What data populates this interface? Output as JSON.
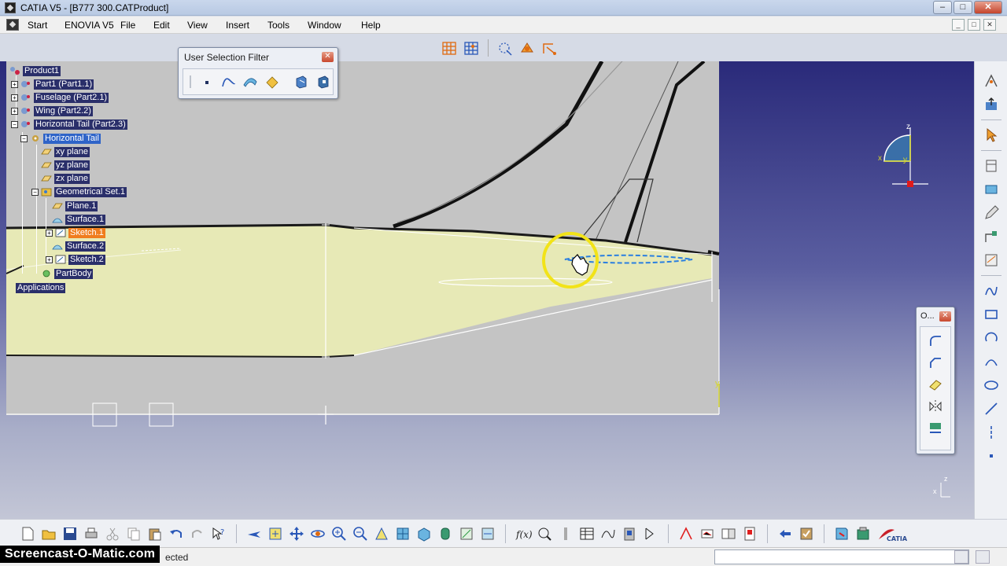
{
  "window": {
    "title": "CATIA V5 - [B777 300.CATProduct]",
    "minimize": "–",
    "restore": "□",
    "close": "✕"
  },
  "menu": {
    "items": [
      {
        "label": "Start"
      },
      {
        "label": "ENOVIA V5"
      },
      {
        "label": "File"
      },
      {
        "label": "Edit"
      },
      {
        "label": "View"
      },
      {
        "label": "Insert"
      },
      {
        "label": "Tools"
      },
      {
        "label": "Window"
      },
      {
        "label": "Help"
      }
    ],
    "mdi_min": "_",
    "mdi_restore": "□",
    "mdi_close": "✕"
  },
  "tree": {
    "root": "Product1",
    "part1": "Part1 (Part1.1)",
    "fuselage": "Fuselage (Part2.1)",
    "wing": "Wing (Part2.2)",
    "htail": "Horizontal Tail (Part2.3)",
    "htail_part": "Horizontal Tail",
    "xy_plane": "xy plane",
    "yz_plane": "yz plane",
    "zx_plane": "zx plane",
    "geoset": "Geometrical Set.1",
    "plane1": "Plane.1",
    "surface1": "Surface.1",
    "sketch1": "Sketch.1",
    "surface2": "Surface.2",
    "sketch2": "Sketch.2",
    "partbody": "PartBody",
    "applications": "Applications"
  },
  "selection_filter": {
    "title": "User Selection Filter",
    "close": "✕"
  },
  "float_panel": {
    "title": "O...",
    "close": "✕"
  },
  "compass": {
    "x_label": "x",
    "y_label": "y",
    "z_label": "z"
  },
  "axis_small": {
    "x_label": "x",
    "z_label": "z"
  },
  "sketch_axis_label": "y",
  "status": {
    "text": "ected",
    "watermark": "Screencast-O-Matic.com"
  },
  "colors": {
    "tree_bg": "#2a2f6a",
    "tree_selected": "#2f64c8",
    "tree_highlight": "#f07d1e",
    "surface_fill": "#e7e9b6",
    "cursor_highlight": "#f2e318"
  }
}
